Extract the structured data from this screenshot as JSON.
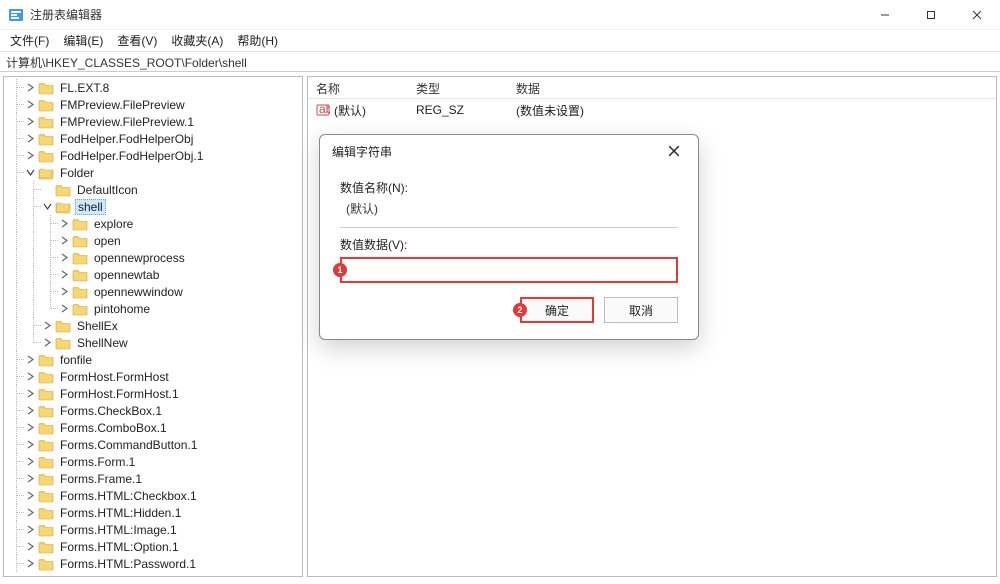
{
  "window": {
    "title": "注册表编辑器"
  },
  "menu": {
    "file": "文件(F)",
    "edit": "编辑(E)",
    "view": "查看(V)",
    "favorites": "收藏夹(A)",
    "help": "帮助(H)"
  },
  "address": "计算机\\HKEY_CLASSES_ROOT\\Folder\\shell",
  "tree": [
    {
      "depth": 1,
      "expander": ">",
      "label": "FL.EXT.8"
    },
    {
      "depth": 1,
      "expander": ">",
      "label": "FMPreview.FilePreview"
    },
    {
      "depth": 1,
      "expander": ">",
      "label": "FMPreview.FilePreview.1"
    },
    {
      "depth": 1,
      "expander": ">",
      "label": "FodHelper.FodHelperObj"
    },
    {
      "depth": 1,
      "expander": ">",
      "label": "FodHelper.FodHelperObj.1"
    },
    {
      "depth": 1,
      "expander": "v",
      "label": "Folder"
    },
    {
      "depth": 2,
      "expander": "",
      "label": "DefaultIcon"
    },
    {
      "depth": 2,
      "expander": "v",
      "label": "shell",
      "selected": true
    },
    {
      "depth": 3,
      "expander": ">",
      "label": "explore"
    },
    {
      "depth": 3,
      "expander": ">",
      "label": "open"
    },
    {
      "depth": 3,
      "expander": ">",
      "label": "opennewprocess"
    },
    {
      "depth": 3,
      "expander": ">",
      "label": "opennewtab"
    },
    {
      "depth": 3,
      "expander": ">",
      "label": "opennewwindow"
    },
    {
      "depth": 3,
      "expander": ">",
      "label": "pintohome",
      "last": true
    },
    {
      "depth": 2,
      "expander": ">",
      "label": "ShellEx"
    },
    {
      "depth": 2,
      "expander": ">",
      "label": "ShellNew",
      "last": true
    },
    {
      "depth": 1,
      "expander": ">",
      "label": "fonfile"
    },
    {
      "depth": 1,
      "expander": ">",
      "label": "FormHost.FormHost"
    },
    {
      "depth": 1,
      "expander": ">",
      "label": "FormHost.FormHost.1"
    },
    {
      "depth": 1,
      "expander": ">",
      "label": "Forms.CheckBox.1"
    },
    {
      "depth": 1,
      "expander": ">",
      "label": "Forms.ComboBox.1"
    },
    {
      "depth": 1,
      "expander": ">",
      "label": "Forms.CommandButton.1"
    },
    {
      "depth": 1,
      "expander": ">",
      "label": "Forms.Form.1"
    },
    {
      "depth": 1,
      "expander": ">",
      "label": "Forms.Frame.1"
    },
    {
      "depth": 1,
      "expander": ">",
      "label": "Forms.HTML:Checkbox.1"
    },
    {
      "depth": 1,
      "expander": ">",
      "label": "Forms.HTML:Hidden.1"
    },
    {
      "depth": 1,
      "expander": ">",
      "label": "Forms.HTML:Image.1"
    },
    {
      "depth": 1,
      "expander": ">",
      "label": "Forms.HTML:Option.1"
    },
    {
      "depth": 1,
      "expander": ">",
      "label": "Forms.HTML:Password.1"
    }
  ],
  "list": {
    "headers": {
      "name": "名称",
      "type": "类型",
      "data": "数据"
    },
    "rows": [
      {
        "name": "(默认)",
        "type": "REG_SZ",
        "data": "(数值未设置)"
      }
    ]
  },
  "dialog": {
    "title": "编辑字符串",
    "name_label": "数值名称(N):",
    "name_value": "(默认)",
    "data_label": "数值数据(V):",
    "data_value": "",
    "ok": "确定",
    "cancel": "取消"
  },
  "annotations": {
    "badge1": "1",
    "badge2": "2"
  }
}
